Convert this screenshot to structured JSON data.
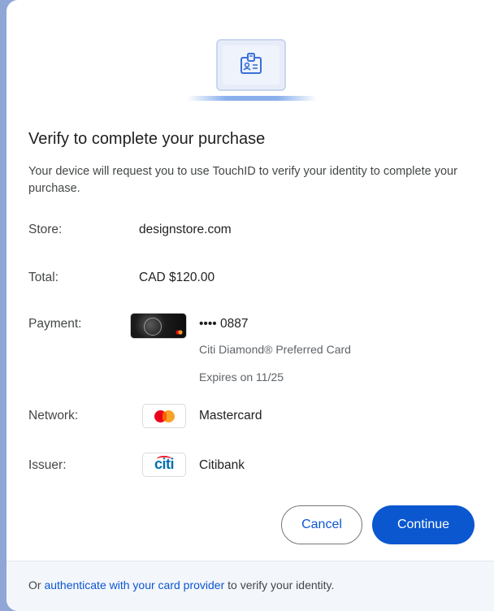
{
  "dialog": {
    "title": "Verify to complete your purchase",
    "description": "Your device will request you to use TouchID to verify your identity to complete your purchase.",
    "hero_icon": "id-badge-icon"
  },
  "details": {
    "store": {
      "label": "Store:",
      "value": "designstore.com"
    },
    "total": {
      "label": "Total:",
      "value": "CAD $120.00"
    },
    "payment": {
      "label": "Payment:",
      "masked_number": "•••• 0887",
      "card_name": "Citi Diamond® Preferred Card",
      "expiry": "Expires on 11/25"
    },
    "network": {
      "label": "Network:",
      "value": "Mastercard"
    },
    "issuer": {
      "label": "Issuer:",
      "value": "Citibank",
      "logo_text": "citi"
    }
  },
  "actions": {
    "cancel_label": "Cancel",
    "continue_label": "Continue"
  },
  "footer": {
    "prefix": "Or ",
    "link_text": "authenticate with your card provider",
    "suffix": " to verify your identity."
  },
  "colors": {
    "accent": "#0b57d0",
    "background": "#8fa6d6",
    "mastercard_red": "#eb001b",
    "mastercard_yellow": "#f79e1b",
    "citi_blue": "#056dae"
  }
}
